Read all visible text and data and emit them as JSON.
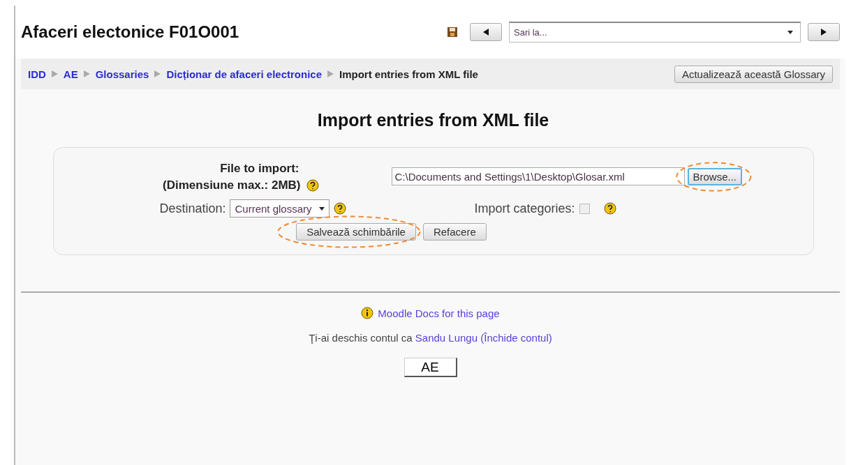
{
  "header": {
    "title": "Afaceri electonice F01O001",
    "jump_select": {
      "value": "Sari la..."
    }
  },
  "breadcrumb": {
    "items": [
      {
        "label": "IDD",
        "link": true
      },
      {
        "label": "AE",
        "link": true
      },
      {
        "label": "Glossaries",
        "link": true
      },
      {
        "label": "Dicționar de afaceri electronice",
        "link": true
      },
      {
        "label": "Import entries from XML file",
        "link": false
      }
    ],
    "button": "Actualizează această Glossary"
  },
  "heading": "Import entries from XML file",
  "form": {
    "file_label": "File to import:",
    "file_note": "(Dimensiune max.: 2MB)",
    "file_value": "C:\\Documents and Settings\\1\\Desktop\\Glosar.xml",
    "browse": {
      "label": "Browse...",
      "highlighted": true
    },
    "destination_label": "Destination:",
    "destination_value": "Current glossary",
    "categories_label": "Import categories:",
    "categories_checked": false,
    "buttons": [
      {
        "label": "Salvează schimbările",
        "highlighted": true
      },
      {
        "label": "Refacere",
        "highlighted": false
      }
    ]
  },
  "footer": {
    "docs_link": "Moodle Docs for this page",
    "login_prefix": "Ţi-ai deschis contul ca",
    "user": "Sandu Lungu",
    "logout": "(Închide contul)",
    "home_button": "AE"
  }
}
